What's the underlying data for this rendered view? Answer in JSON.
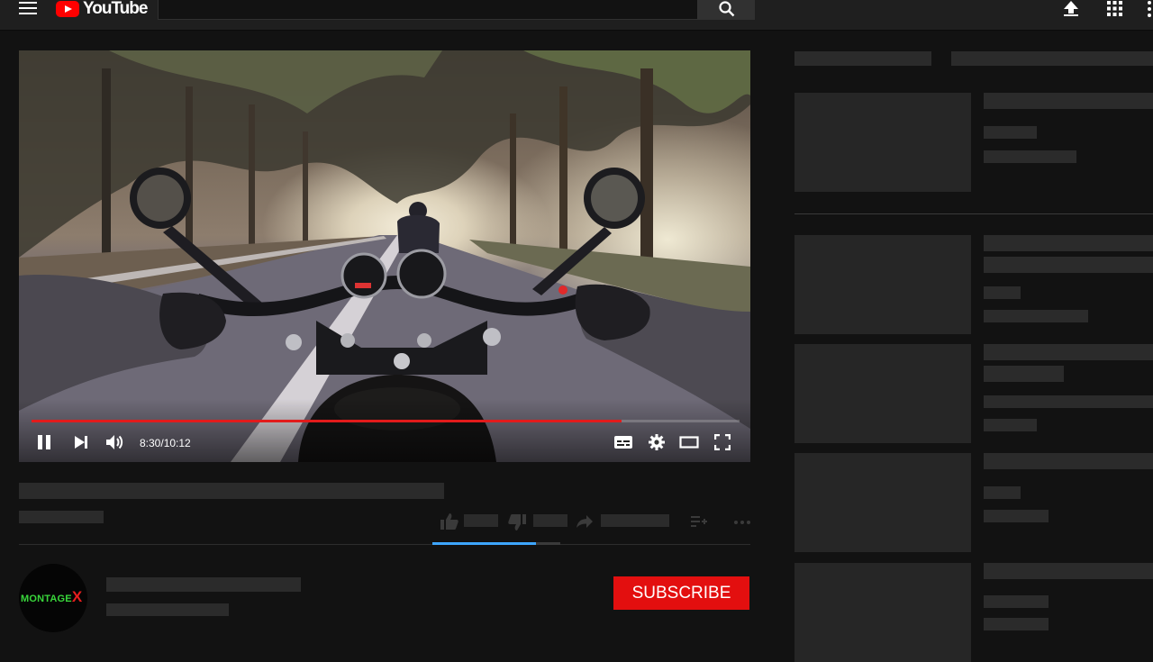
{
  "header": {
    "logo_text": "YouTube",
    "icons": [
      "menu-icon",
      "youtube-play-icon",
      "search-icon",
      "upload-icon",
      "apps-icon",
      "more-icon"
    ]
  },
  "player": {
    "time_display": "8:30/10:12",
    "progress_fraction": 0.833,
    "state": "playing",
    "accent_color": "#e21b1b",
    "controls": [
      "pause-icon",
      "next-icon",
      "volume-icon",
      "subtitles-icon",
      "settings-icon",
      "theater-icon",
      "fullscreen-icon"
    ]
  },
  "actions": {
    "icons": [
      "like-icon",
      "dislike-icon",
      "share-icon",
      "save-to-playlist-icon",
      "more-actions-icon"
    ],
    "like_fraction": 0.81
  },
  "channel": {
    "avatar_brand": "MONTAGE",
    "avatar_brand_x": "X",
    "subscribe_label": "SUBSCRIBE",
    "subscribe_color": "#e30f0f"
  }
}
